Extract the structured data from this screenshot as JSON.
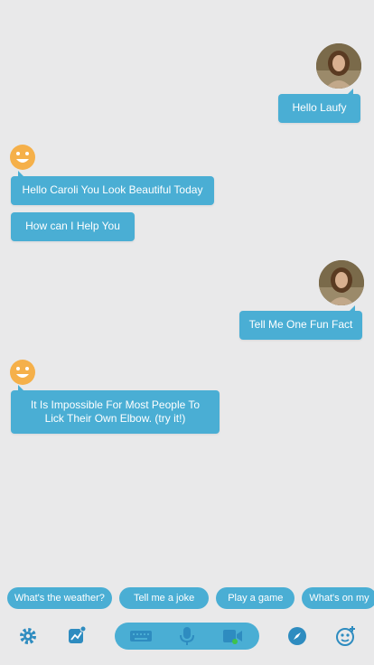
{
  "conversation": [
    {
      "from": "user",
      "text": "Hello Laufy"
    },
    {
      "from": "bot",
      "text": "Hello Caroli You Look Beautiful Today"
    },
    {
      "from": "bot",
      "text": "How can I Help You"
    },
    {
      "from": "user",
      "text": "Tell Me One Fun Fact"
    },
    {
      "from": "bot",
      "text": "It Is Impossible For Most People To Lick Their Own Elbow. (try it!)"
    }
  ],
  "suggestions": [
    "What's the weather?",
    "Tell me a joke",
    "Play a game",
    "What's on my"
  ],
  "toolbar": {
    "icons": [
      "gear-icon",
      "trends-icon",
      "keyboard-icon",
      "microphone-icon",
      "video-icon",
      "compass-icon",
      "bot-face-icon"
    ]
  },
  "colors": {
    "background": "#e9e9ea",
    "accent": "#4aaed4",
    "icon": "#2e8cc0",
    "online": "#3fc24b",
    "bot_face": "#f5b04a"
  }
}
